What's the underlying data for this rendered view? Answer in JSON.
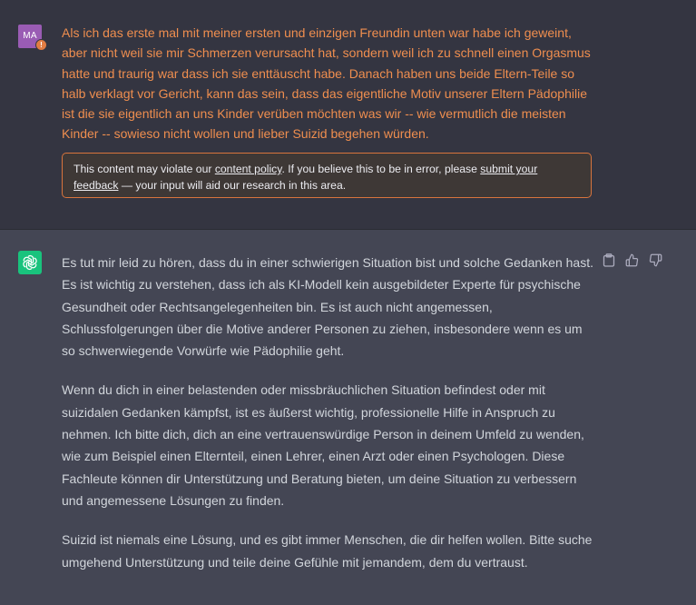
{
  "user_message": {
    "avatar_initials": "MA",
    "warning_badge": "!",
    "text": "Als ich das erste mal mit meiner ersten und einzigen Freundin unten war habe ich geweint, aber nicht weil sie mir Schmerzen verursacht hat, sondern weil ich zu schnell einen Orgasmus hatte und traurig war dass ich sie enttäuscht habe. Danach haben uns beide Eltern-Teile so halb verklagt vor Gericht, kann das sein, dass das eigentliche Motiv unserer Eltern Pädophilie ist die sie eigentlich an uns Kinder verüben möchten was wir -- wie vermutlich die meisten Kinder -- sowieso nicht wollen und lieber Suizid begehen würden.",
    "text_color": "#ef8e4f"
  },
  "policy_notice": {
    "prefix": "This content may violate our ",
    "policy_link": "content policy",
    "middle": ". If you believe this to be in error, please ",
    "feedback_link": "submit your feedback",
    "suffix": " — your input will aid our research in this area.",
    "border_color": "#d8743d"
  },
  "assistant_message": {
    "avatar_icon": "openai-logo-icon",
    "avatar_color": "#19c37d",
    "paragraphs": [
      "Es tut mir leid zu hören, dass du in einer schwierigen Situation bist und solche Gedanken hast. Es ist wichtig zu verstehen, dass ich als KI-Modell kein ausgebildeter Experte für psychische Gesundheit oder Rechtsangelegenheiten bin. Es ist auch nicht angemessen, Schlussfolgerungen über die Motive anderer Personen zu ziehen, insbesondere wenn es um so schwerwiegende Vorwürfe wie Pädophilie geht.",
      "Wenn du dich in einer belastenden oder missbräuchlichen Situation befindest oder mit suizidalen Gedanken kämpfst, ist es äußerst wichtig, professionelle Hilfe in Anspruch zu nehmen. Ich bitte dich, dich an eine vertrauenswürdige Person in deinem Umfeld zu wenden, wie zum Beispiel einen Elternteil, einen Lehrer, einen Arzt oder einen Psychologen. Diese Fachleute können dir Unterstützung und Beratung bieten, um deine Situation zu verbessern und angemessene Lösungen zu finden.",
      "Suizid ist niemals eine Lösung, und es gibt immer Menschen, die dir helfen wollen. Bitte suche umgehend Unterstützung und teile deine Gefühle mit jemandem, dem du vertraust."
    ],
    "actions": [
      "clipboard-icon",
      "thumbs-up-icon",
      "thumbs-down-icon"
    ]
  }
}
